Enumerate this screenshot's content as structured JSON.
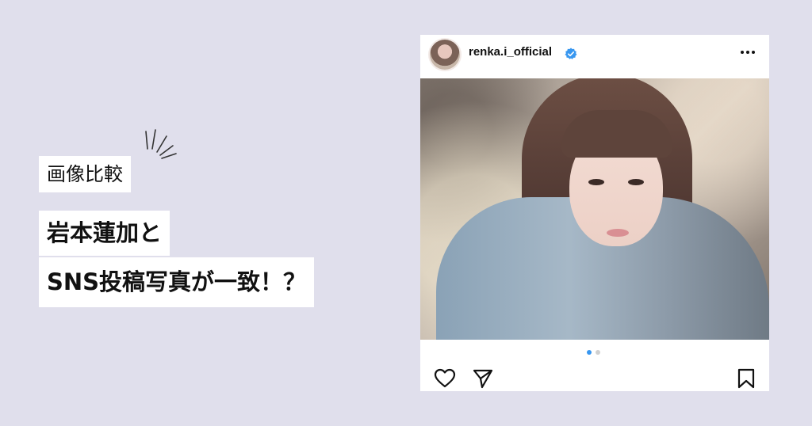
{
  "tag_label": "画像比較",
  "headline": {
    "line1": "岩本蓮加と",
    "line2": "SNS投稿写真が一致！？"
  },
  "post": {
    "username": "renka.i_official",
    "verified": true,
    "carousel": {
      "total": 2,
      "active": 1
    }
  },
  "icons": {
    "avatar": "profile-avatar",
    "verified": "verified-badge-icon",
    "more": "more-options-icon",
    "like": "heart-icon",
    "share": "send-icon",
    "save": "bookmark-icon",
    "accent": "sparkle-lines-icon"
  },
  "colors": {
    "background": "#e0dfec",
    "verified": "#3897f0",
    "carousel_active": "#3897f0"
  }
}
